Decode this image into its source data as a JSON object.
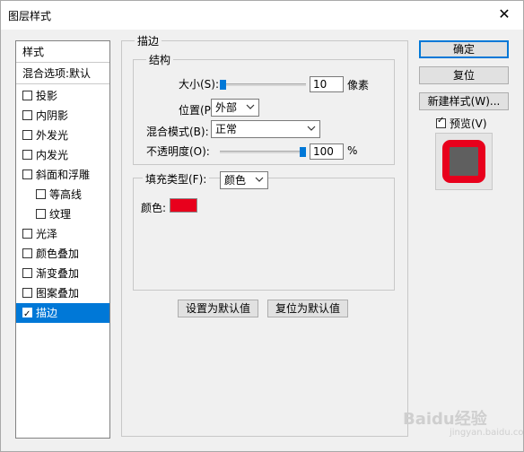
{
  "window": {
    "title": "图层样式",
    "close_symbol": "✕"
  },
  "left": {
    "header": "样式",
    "blend": "混合选项:默认",
    "items": [
      {
        "label": "投影",
        "checked": false,
        "indent": false
      },
      {
        "label": "内阴影",
        "checked": false,
        "indent": false
      },
      {
        "label": "外发光",
        "checked": false,
        "indent": false
      },
      {
        "label": "内发光",
        "checked": false,
        "indent": false
      },
      {
        "label": "斜面和浮雕",
        "checked": false,
        "indent": false
      },
      {
        "label": "等高线",
        "checked": false,
        "indent": true
      },
      {
        "label": "纹理",
        "checked": false,
        "indent": true
      },
      {
        "label": "光泽",
        "checked": false,
        "indent": false
      },
      {
        "label": "颜色叠加",
        "checked": false,
        "indent": false
      },
      {
        "label": "渐变叠加",
        "checked": false,
        "indent": false
      },
      {
        "label": "图案叠加",
        "checked": false,
        "indent": false
      },
      {
        "label": "描边",
        "checked": true,
        "indent": false,
        "selected": true
      }
    ]
  },
  "stroke": {
    "section_title": "描边",
    "structure_title": "结构",
    "size_label": "大小(S):",
    "size_value": "10",
    "size_unit": "像素",
    "position_label": "位置(P):",
    "position_value": "外部",
    "blend_label": "混合模式(B):",
    "blend_value": "正常",
    "opacity_label": "不透明度(O):",
    "opacity_value": "100",
    "opacity_unit": "%",
    "fill_type_label": "填充类型(F):",
    "fill_type_value": "颜色",
    "color_label": "颜色:",
    "color_hex": "#e8001c",
    "set_default": "设置为默认值",
    "reset_default": "复位为默认值"
  },
  "buttons": {
    "ok": "确定",
    "reset": "复位",
    "new_style": "新建样式(W)...",
    "preview_label": "预览(V)",
    "preview_checked": true
  },
  "watermark": {
    "text": "Baidu经验",
    "sub": "jingyan.baidu.com"
  }
}
